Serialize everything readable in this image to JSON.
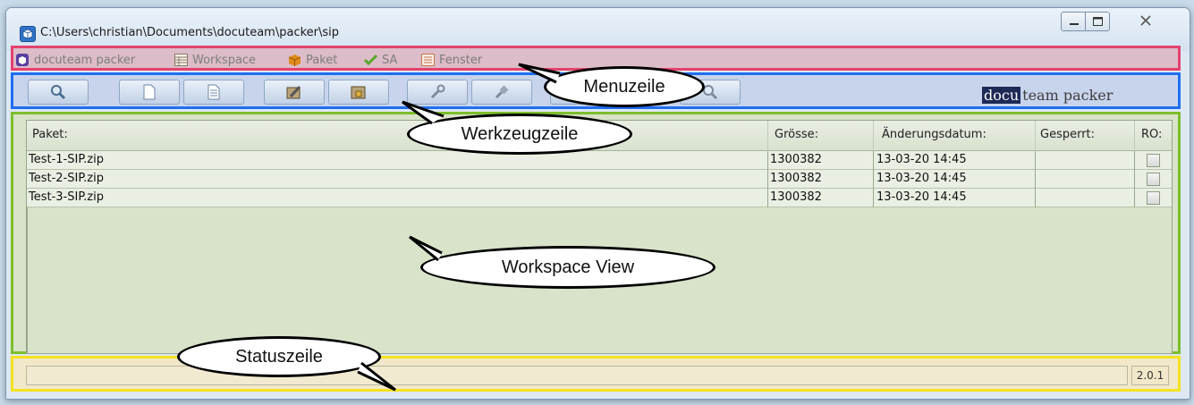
{
  "window": {
    "title": "C:\\Users\\christian\\Documents\\docuteam\\packer\\sip"
  },
  "menu": {
    "items": [
      {
        "label": "docuteam packer",
        "icon": "packer-app-icon"
      },
      {
        "label": "Workspace",
        "icon": "workspace-table-icon"
      },
      {
        "label": "Paket",
        "icon": "package-box-icon"
      },
      {
        "label": "SA",
        "icon": "checkmark-icon"
      },
      {
        "label": "Fenster",
        "icon": "window-list-icon"
      }
    ]
  },
  "toolbar": {
    "logo_dark": "docu",
    "logo_light": "team packer"
  },
  "table": {
    "columns": [
      "Paket:",
      "Grösse:",
      "Änderungsdatum:",
      "Gesperrt:",
      "RO:"
    ],
    "rows": [
      {
        "name": "Test-1-SIP.zip",
        "size": "1300382",
        "date": "13-03-20 14:45",
        "locked": "",
        "ro": false
      },
      {
        "name": "Test-2-SIP.zip",
        "size": "1300382",
        "date": "13-03-20 14:45",
        "locked": "",
        "ro": false
      },
      {
        "name": "Test-3-SIP.zip",
        "size": "1300382",
        "date": "13-03-20 14:45",
        "locked": "",
        "ro": false
      }
    ]
  },
  "status": {
    "text": "",
    "version": "2.0.1"
  },
  "callouts": {
    "menu": "Menuzeile",
    "toolbar": "Werkzeugzeile",
    "workspace": "Workspace View",
    "status": "Statuszeile"
  },
  "colors": {
    "menu_border": "#e4426e",
    "toolbar_border": "#1f6ef2",
    "workspace_border": "#7dbe2c",
    "status_border": "#f5e21f",
    "logo_dark_bg": "#1c2a55"
  }
}
